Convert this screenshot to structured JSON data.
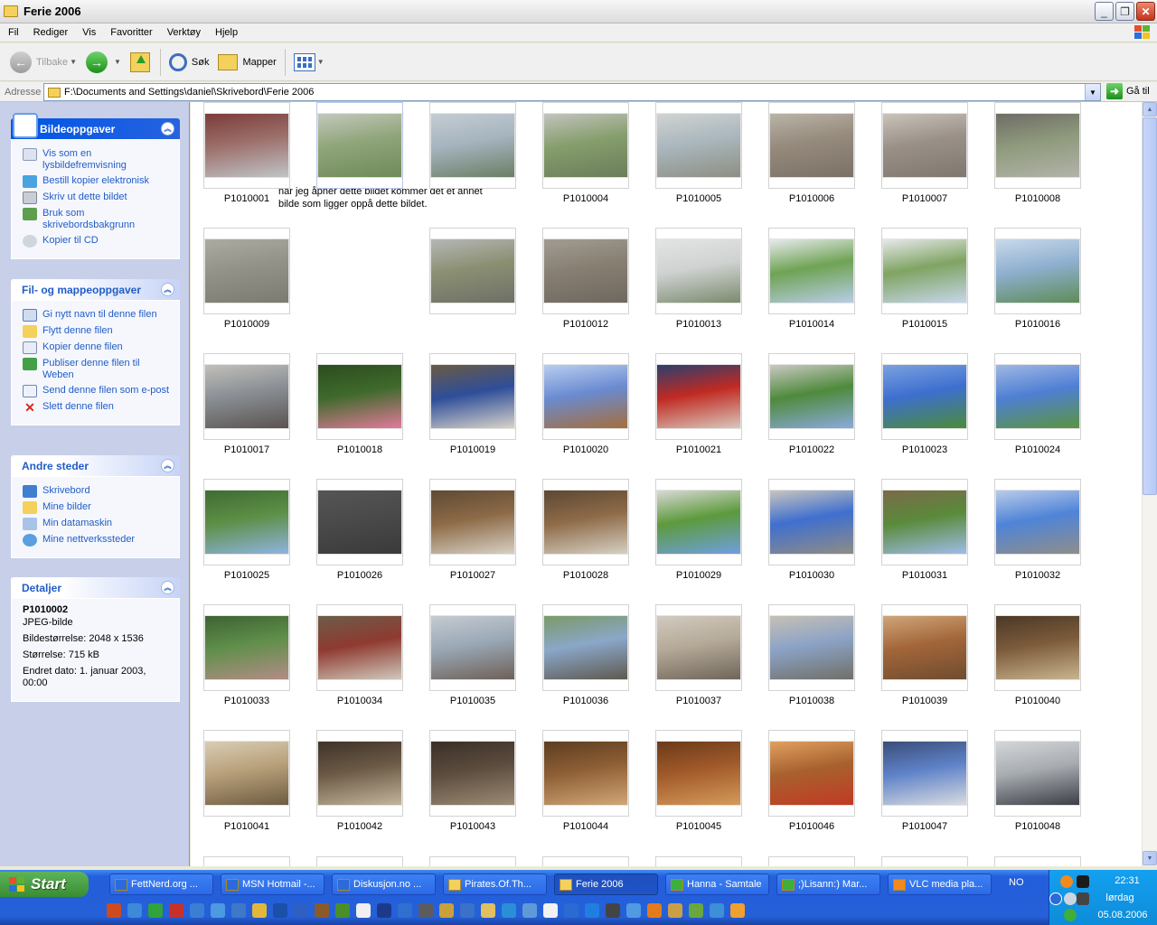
{
  "window": {
    "title": "Ferie 2006"
  },
  "menu": [
    "Fil",
    "Rediger",
    "Vis",
    "Favoritter",
    "Verktøy",
    "Hjelp"
  ],
  "toolbar": {
    "back": "Tilbake",
    "search": "Søk",
    "folders": "Mapper"
  },
  "address": {
    "label": "Adresse",
    "path": "F:\\Documents and Settings\\daniel\\Skrivebord\\Ferie 2006",
    "go": "Gå til"
  },
  "panels": {
    "picture_tasks": {
      "title": "Bildeoppgaver",
      "items": [
        "Vis som en lysbildefremvisning",
        "Bestill kopier elektronisk",
        "Skriv ut dette bildet",
        "Bruk som skrivebordsbakgrunn",
        "Kopier til CD"
      ]
    },
    "file_tasks": {
      "title": "Fil- og mappeoppgaver",
      "items": [
        "Gi nytt navn til denne filen",
        "Flytt denne filen",
        "Kopier denne filen",
        "Publiser denne filen til Weben",
        "Send denne filen som e-post",
        "Slett denne filen"
      ]
    },
    "other_places": {
      "title": "Andre steder",
      "items": [
        "Skrivebord",
        "Mine bilder",
        "Min datamaskin",
        "Mine nettverkssteder"
      ]
    },
    "details": {
      "title": "Detaljer",
      "name": "P1010002",
      "type": "JPEG-bilde",
      "dimensions": "Bildestørrelse: 2048 x 1536",
      "size": "Størrelse: 715 kB",
      "modified": "Endret dato: 1. januar 2003, 00:00"
    }
  },
  "tooltip": "når jeg åpner dette bildet kommer det et annet bilde som ligger oppå dette bildet.",
  "thumbnails": [
    {
      "name": "P1010001",
      "colors": [
        "#9c6f6a",
        "#c0c4c8",
        "#7b3c3a"
      ]
    },
    {
      "name": "",
      "colors": [
        "#8fa57a",
        "#6f8a5a",
        "#c3c8bc"
      ]
    },
    {
      "name": "",
      "colors": [
        "#a5b4bf",
        "#6a7f64",
        "#c5ccd2"
      ]
    },
    {
      "name": "P1010004",
      "colors": [
        "#869e6c",
        "#6b7d5b",
        "#c2c3be"
      ]
    },
    {
      "name": "P1010005",
      "colors": [
        "#aab7bd",
        "#8d8f83",
        "#d0d3d2"
      ]
    },
    {
      "name": "P1010006",
      "colors": [
        "#958a7c",
        "#7b7166",
        "#b9b3a7"
      ]
    },
    {
      "name": "P1010007",
      "colors": [
        "#9a9088",
        "#7f786f",
        "#c9c3ba"
      ]
    },
    {
      "name": "P1010008",
      "colors": [
        "#8e9a7c",
        "#b2b3a9",
        "#6f6c66"
      ]
    },
    {
      "name": "P1010009",
      "colors": [
        "#929289",
        "#7c7b72",
        "#acaba2"
      ]
    },
    {
      "name": "",
      "colors": [
        "#ffffff",
        "#ffffff",
        "#ffffff"
      ]
    },
    {
      "name": "",
      "colors": [
        "#8b9073",
        "#6f6f66",
        "#b5b7b4"
      ]
    },
    {
      "name": "P1010012",
      "colors": [
        "#877f72",
        "#6f6860",
        "#a19c92"
      ]
    },
    {
      "name": "P1010013",
      "colors": [
        "#cfd2d1",
        "#7b8b6e",
        "#e3e5e3"
      ]
    },
    {
      "name": "P1010014",
      "colors": [
        "#6fa354",
        "#b8cde6",
        "#e7eaec"
      ]
    },
    {
      "name": "P1010015",
      "colors": [
        "#7fa462",
        "#c6d6ea",
        "#e6e8ea"
      ]
    },
    {
      "name": "P1010016",
      "colors": [
        "#8fb0d0",
        "#5f8c58",
        "#c9d9ea"
      ]
    },
    {
      "name": "P1010017",
      "colors": [
        "#8a8f95",
        "#5a5450",
        "#c1c0ba"
      ]
    },
    {
      "name": "P1010018",
      "colors": [
        "#3f6a2c",
        "#e27a9a",
        "#2c4c1e"
      ]
    },
    {
      "name": "P1010019",
      "colors": [
        "#2e4e9a",
        "#d8d4c8",
        "#6b5a44"
      ]
    },
    {
      "name": "P1010020",
      "colors": [
        "#6a8bd0",
        "#a56e3c",
        "#b9cdf0"
      ]
    },
    {
      "name": "P1010021",
      "colors": [
        "#c02a22",
        "#d9c7bb",
        "#2b3f70"
      ]
    },
    {
      "name": "P1010022",
      "colors": [
        "#4f8a3c",
        "#8aaadc",
        "#c9c9c2"
      ]
    },
    {
      "name": "P1010023",
      "colors": [
        "#3d6fcf",
        "#4b8b3a",
        "#7ba1df"
      ]
    },
    {
      "name": "P1010024",
      "colors": [
        "#4f7fd4",
        "#5a943f",
        "#9fb8e3"
      ]
    },
    {
      "name": "P1010025",
      "colors": [
        "#5d8f46",
        "#8fb3e0",
        "#3f6b33"
      ]
    },
    {
      "name": "P1010026",
      "colors": [
        "#4a4a4a",
        "#3a3a3a",
        "#555555"
      ]
    },
    {
      "name": "P1010027",
      "colors": [
        "#8c6a46",
        "#d7d0c3",
        "#5f4a35"
      ]
    },
    {
      "name": "P1010028",
      "colors": [
        "#8e6b48",
        "#d6cfc2",
        "#5c4834"
      ]
    },
    {
      "name": "P1010029",
      "colors": [
        "#5c9a3c",
        "#6f9fe0",
        "#d9d9d4"
      ]
    },
    {
      "name": "P1010030",
      "colors": [
        "#3f6fcf",
        "#8f8c86",
        "#c8c5be"
      ]
    },
    {
      "name": "P1010031",
      "colors": [
        "#5a8a3a",
        "#9ebce8",
        "#7a6a4a"
      ]
    },
    {
      "name": "P1010032",
      "colors": [
        "#4f84d8",
        "#8e8e8a",
        "#b9cbe8"
      ]
    },
    {
      "name": "P1010033",
      "colors": [
        "#5f8f4a",
        "#b38c86",
        "#3d6233"
      ]
    },
    {
      "name": "P1010034",
      "colors": [
        "#8f3a30",
        "#cfc8bc",
        "#6c5c4a"
      ]
    },
    {
      "name": "P1010035",
      "colors": [
        "#9aa8b6",
        "#6e6158",
        "#c5cbd1"
      ]
    },
    {
      "name": "P1010036",
      "colors": [
        "#8aa7c9",
        "#5f5a4f",
        "#7c9968"
      ]
    },
    {
      "name": "P1010037",
      "colors": [
        "#b5aa98",
        "#6f655a",
        "#d1cabf"
      ]
    },
    {
      "name": "P1010038",
      "colors": [
        "#8ca3c6",
        "#707068",
        "#c6c0b4"
      ]
    },
    {
      "name": "P1010039",
      "colors": [
        "#a3663a",
        "#6f4c2f",
        "#cfa57a"
      ]
    },
    {
      "name": "P1010040",
      "colors": [
        "#7c5b3a",
        "#c9b48f",
        "#4a3828"
      ]
    },
    {
      "name": "P1010041",
      "colors": [
        "#b8a07a",
        "#6e5c42",
        "#d9cdb5"
      ]
    },
    {
      "name": "P1010042",
      "colors": [
        "#6c5a46",
        "#c3b49b",
        "#3e3228"
      ]
    },
    {
      "name": "P1010043",
      "colors": [
        "#5c4c3e",
        "#9b8a74",
        "#3a2f26"
      ]
    },
    {
      "name": "P1010044",
      "colors": [
        "#8e5f35",
        "#d1a676",
        "#5c3d22"
      ]
    },
    {
      "name": "P1010045",
      "colors": [
        "#a15a2a",
        "#d59a5a",
        "#6a3a1a"
      ]
    },
    {
      "name": "P1010046",
      "colors": [
        "#a8612e",
        "#c13a24",
        "#e0a060"
      ]
    },
    {
      "name": "P1010047",
      "colors": [
        "#5e82c8",
        "#d9dbe0",
        "#3b4d78"
      ]
    },
    {
      "name": "P1010048",
      "colors": [
        "#a7acb1",
        "#3d3f46",
        "#d4d6d8"
      ]
    }
  ],
  "next_row_count": 8,
  "taskbar": {
    "start": "Start",
    "tasks": [
      {
        "label": "FettNerd.org ...",
        "active": false
      },
      {
        "label": "MSN Hotmail -...",
        "active": false
      },
      {
        "label": "Diskusjon.no ...",
        "active": false
      },
      {
        "label": "Pirates.Of.Th...",
        "active": false
      },
      {
        "label": "Ferie 2006",
        "active": true
      },
      {
        "label": "Hanna - Samtale",
        "active": false
      },
      {
        "label": ";)Lisann:) Mar...",
        "active": false
      },
      {
        "label": "VLC media pla...",
        "active": false
      }
    ],
    "language": "NO",
    "time": "22:31",
    "day": "lørdag",
    "date": "05.08.2006"
  },
  "quicklaunch_colors": [
    "#d04a1f",
    "#3c8ad8",
    "#2ea43a",
    "#c8302a",
    "#3b7fd4",
    "#4c9adf",
    "#3d78c9",
    "#e3b83a",
    "#1b4fa8",
    "#2e5fc4",
    "#8b5a2a",
    "#4a8f2a",
    "#f0f0f0",
    "#1d3a8a",
    "#2f6fd0",
    "#5c5c5c",
    "#c9a03a",
    "#3a72c9",
    "#e0c060",
    "#2a8fd6",
    "#5e9ad8",
    "#f2f2f2",
    "#2a6bd2",
    "#1f7fe0",
    "#444444",
    "#4f9ae0",
    "#e37b1c",
    "#c9a047",
    "#6aa83f",
    "#3d8fd6",
    "#f0a030"
  ]
}
